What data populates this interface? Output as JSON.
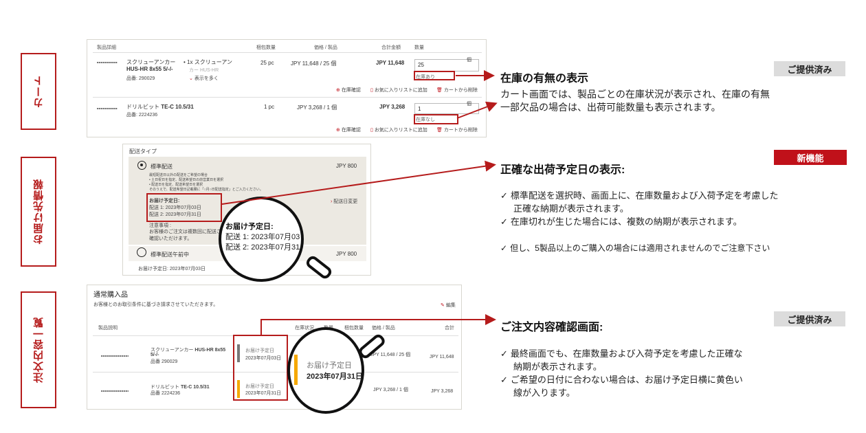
{
  "side_labels": {
    "cart": "カート",
    "delivery": "お届け先情報",
    "order": "注文内容一覧"
  },
  "cart": {
    "headers": {
      "product": "製品詳細",
      "pack": "梱包数量",
      "price": "価格 / 製品",
      "total": "合計金額",
      "qty": "数量"
    },
    "row1": {
      "name1": "スクリューアンカー",
      "name2": "HUS-HR 8x55 5/-/-",
      "code": "品番: 290029",
      "bullet1": "1x スクリューアン",
      "bullet2": "カー HUS-HR",
      "more": "表示を多く",
      "pack": "25 pc",
      "price": "JPY 11,648 / 25 個",
      "total": "JPY 11,648",
      "qty": "25",
      "unit": "個",
      "stock": "在庫あり"
    },
    "row2": {
      "name1": "ドリルビット",
      "name2": "TE-C 10.5/31",
      "code": "品番: 2224236",
      "pack": "1 pc",
      "price": "JPY 3,268 / 1 個",
      "total": "JPY 3,268",
      "qty": "1",
      "unit": "個",
      "stock": "在庫なし"
    },
    "actions": {
      "stock_check": "在庫確認",
      "favorite": "お気に入りリストに追加",
      "remove": "カートから削除"
    }
  },
  "delivery": {
    "title": "配送タイプ",
    "standard": {
      "label": "標準配送",
      "price": "JPY 800",
      "notes": [
        "最短配送日以外の配送をご希望の場合",
        "• 土日祝日を指定、配送希望日の前営業日を選択",
        "• 配送日を指定、配送希望日を選択",
        "そのうえで、配送希望日記載欄に「○月○日配送指定」とご入力ください。"
      ],
      "eta_title": "お届け予定日:",
      "eta1": "配送 1: 2023年07月03日",
      "eta2": "配送 2: 2023年07月31日",
      "change": "配送日変更",
      "caution_title": "注意事項 :",
      "caution1": "お客様のご注文は複数回に配送さ",
      "caution2": "確認いただけます。"
    },
    "morning": {
      "label": "標準配送午前中",
      "price": "JPY 800",
      "eta": "お届け予定日: 2023年07月03日"
    },
    "zoom": {
      "title": "お届け予定日:",
      "eta1": "配送 1: 2023年07月03日",
      "eta2": "配送 2: 2023年07月31日"
    }
  },
  "order": {
    "title": "通常購入品",
    "subtitle": "お客様とのお取引条件に基づき請求させていただきます。",
    "edit": "編集",
    "headers": {
      "product": "製品説明",
      "stock": "在庫状況",
      "qty": "数量",
      "pack": "梱包数量",
      "price": "価格 / 製品",
      "total": "合計"
    },
    "row1": {
      "name1": "スクリューアンカー",
      "name2": "HUS-HR 8x55",
      "name3": "5/-/-",
      "code": "品番 290029",
      "eta_label": "お届け予定日",
      "eta": "2023年07月03日",
      "price": "JPY 11,648 / 25 個",
      "total": "JPY 11,648"
    },
    "row2": {
      "name1": "ドリルビット",
      "name2": "TE-C 10.5/31",
      "code": "品番 2224236",
      "eta_label": "お届け予定日",
      "eta": "2023年07月31日",
      "price": "JPY 3,268 / 1 個",
      "total": "JPY 3,268"
    },
    "zoom": {
      "label": "お届け予定日",
      "date": "2023年07月31日"
    }
  },
  "callouts": {
    "stock": {
      "badge": "ご提供済み",
      "title": "在庫の有無の表示",
      "text1": "カート画面では、製品ごとの在庫状況が表示され、在庫の有無",
      "text2": "一部欠品の場合は、出荷可能数量も表示されます。"
    },
    "eta": {
      "badge": "新機能",
      "title": "正確な出荷予定日の表示:",
      "c1a": "標準配送を選択時、画面上に、在庫数量および入荷予定を考慮した",
      "c1b": "正確な納期が表示されます。",
      "c2": "在庫切れが生じた場合には、複数の納期が表示されます。",
      "c3": "但し、5製品以上のご購入の場合には適用されませんのでご注意下さい"
    },
    "confirm": {
      "badge": "ご提供済み",
      "title": "ご注文内容確認画面:",
      "c1a": "最終画面でも、在庫数量および入荷予定を考慮した正確な",
      "c1b": "納期が表示されます。",
      "c2a": "ご希望の日付に合わない場合は、お届け予定日横に黄色い",
      "c2b": "線が入ります。"
    }
  },
  "colors": {
    "accent": "#b51b1b",
    "badge_red": "#c0111a",
    "badge_grey": "#dcdcdc",
    "yellow_bar": "#f5a800",
    "grey_bar": "#777777"
  },
  "checkmark": "✓"
}
